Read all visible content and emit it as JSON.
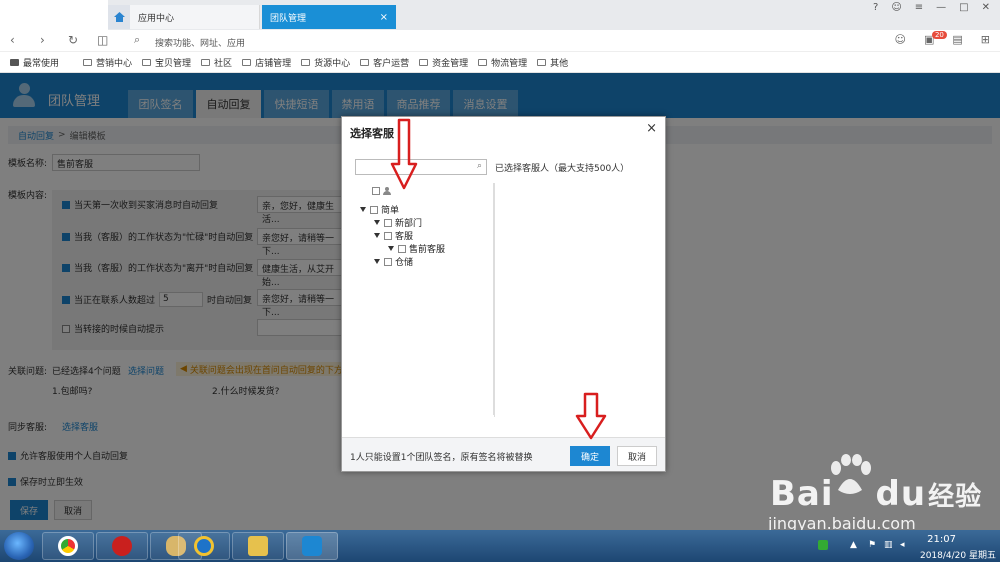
{
  "browser": {
    "tabs": [
      {
        "label": "应用中心",
        "active": false
      },
      {
        "label": "团队管理",
        "active": true
      }
    ],
    "tab_close": "×",
    "search_placeholder": "搜索功能、网址、应用",
    "notification_count": "20",
    "bookmarks": [
      "最常使用",
      "营销中心",
      "宝贝管理",
      "社区",
      "店铺管理",
      "货源中心",
      "客户运营",
      "资金管理",
      "物流管理",
      "其他"
    ]
  },
  "app": {
    "title": "团队管理",
    "tabs": [
      "团队签名",
      "自动回复",
      "快捷短语",
      "禁用语",
      "商品推荐",
      "消息设置"
    ],
    "active_tab": "自动回复",
    "accent": "#1d87d2"
  },
  "page": {
    "breadcrumb": [
      "自动回复",
      ">",
      "编辑模板"
    ],
    "template_name_label": "模板名称:",
    "template_name_value": "售前客服",
    "template_content_label": "模板内容:",
    "rules": [
      {
        "label": "当天第一次收到买家消息时自动回复",
        "checked": true,
        "reply": "亲，您好，健康生活..."
      },
      {
        "label": "当我（客服）的工作状态为\"忙碌\"时自动回复",
        "checked": true,
        "reply": "亲您好，请稍等一下..."
      },
      {
        "label": "当我（客服）的工作状态为\"离开\"时自动回复",
        "checked": true,
        "reply": "健康生活，从艾开始..."
      },
      {
        "label_prefix": "当正在联系人数超过",
        "count": "5",
        "label_suffix": "时自动回复",
        "checked": true,
        "reply": "亲您好，请稍等一下..."
      },
      {
        "label": "当转接的时候自动提示",
        "checked": false,
        "reply": ""
      }
    ],
    "related_label": "关联问题:",
    "related_selected": "已经选择4个问题",
    "select_question_link": "选择问题",
    "related_notice": "关联问题会出现在首问自动回复的下方",
    "questions": [
      "1.包邮吗?",
      "2.什么时候发货?"
    ],
    "sync_label": "同步客服:",
    "select_agent_link": "选择客服",
    "allow_personal": "允许客服使用个人自动回复",
    "apply_on_save": "保存时立即生效",
    "save_btn": "保存",
    "cancel_btn": "取消"
  },
  "modal": {
    "title": "选择客服",
    "close": "×",
    "search_icon": "magnifier-icon",
    "selected_label": "已选择客服人（最大支持500人）",
    "tree": [
      {
        "label": "简单",
        "level": 0,
        "expanded": true
      },
      {
        "label": "新部门",
        "level": 1,
        "expanded": true
      },
      {
        "label": "客服",
        "level": 1,
        "expanded": true
      },
      {
        "label": "售前客服",
        "level": 2,
        "expanded": true
      },
      {
        "label": "仓储",
        "level": 1,
        "expanded": true
      }
    ],
    "footer_note": "1人只能设置1个团队签名，原有签名将被替换",
    "ok_btn": "确定",
    "cancel_btn": "取消"
  },
  "watermark": {
    "brand": "Bai",
    "brand2": "du",
    "cn": "经验",
    "url": "jingyan.baidu.com"
  },
  "taskbar": {
    "time": "21:07",
    "date": "2018/4/20 星期五"
  }
}
